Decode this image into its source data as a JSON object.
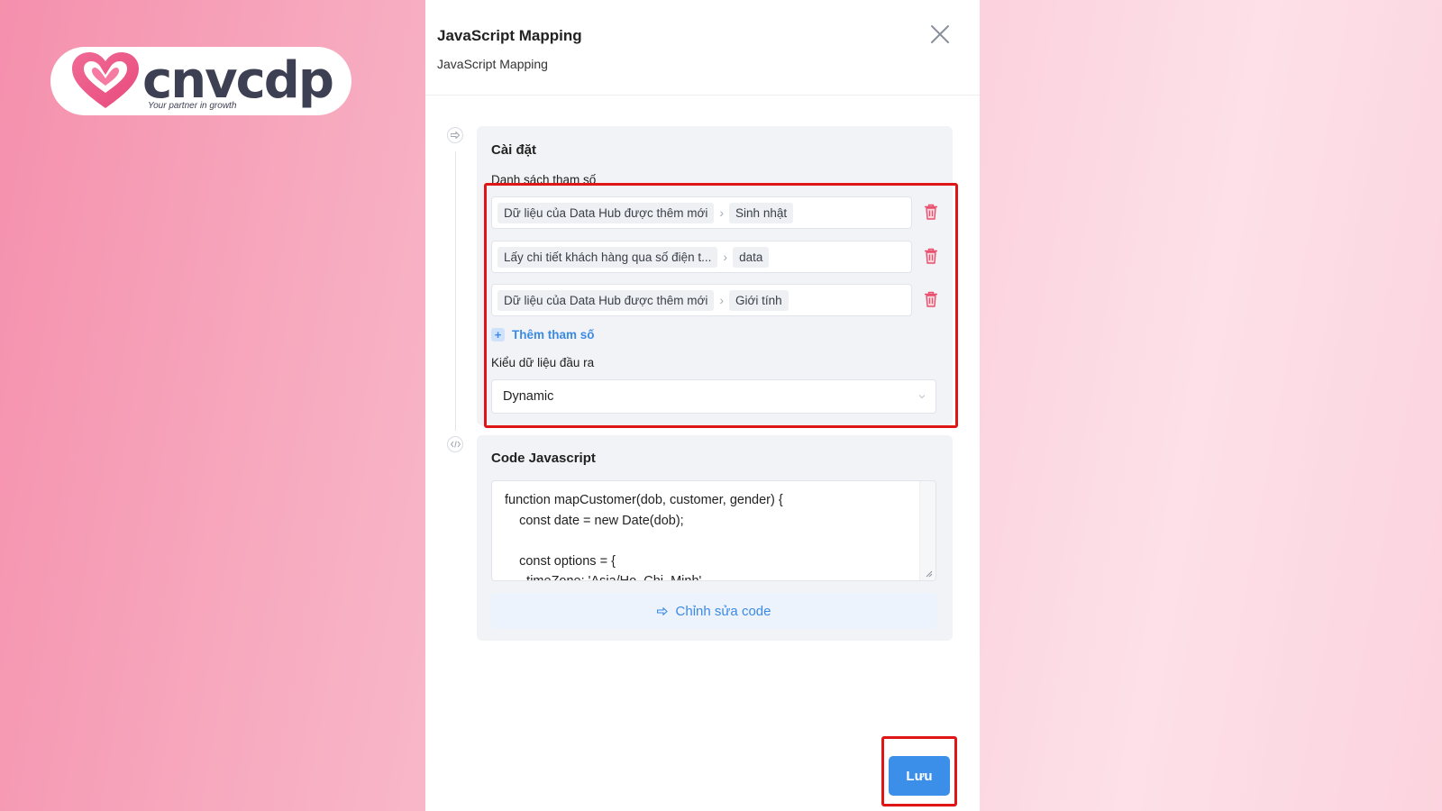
{
  "logo": {
    "word": "cnvcdp",
    "tagline": "Your partner in growth"
  },
  "panel": {
    "title": "JavaScript Mapping",
    "subtitle": "JavaScript Mapping"
  },
  "settings": {
    "title": "Cài đặt",
    "params_label": "Danh sách tham số",
    "params": [
      {
        "source": "Dữ liệu của Data Hub được thêm mới",
        "field": "Sinh nhật"
      },
      {
        "source": "Lấy chi tiết khách hàng qua số điện t...",
        "field": "data"
      },
      {
        "source": "Dữ liệu của Data Hub được thêm mới",
        "field": "Giới tính"
      }
    ],
    "add_param": "Thêm tham số",
    "output_type_label": "Kiểu dữ liệu đầu ra",
    "output_type_value": "Dynamic"
  },
  "code": {
    "title": "Code Javascript",
    "lines": "function mapCustomer(dob, customer, gender) {\n    const date = new Date(dob);\n\n    const options = {\n      timeZone: 'Asia/Ho_Chi_Minh',",
    "edit_button": "Chỉnh sửa code"
  },
  "footer": {
    "save_label": "Lưu"
  },
  "colors": {
    "accent": "#3b8fe8",
    "highlight": "#e01616",
    "delete": "#e8506e"
  }
}
